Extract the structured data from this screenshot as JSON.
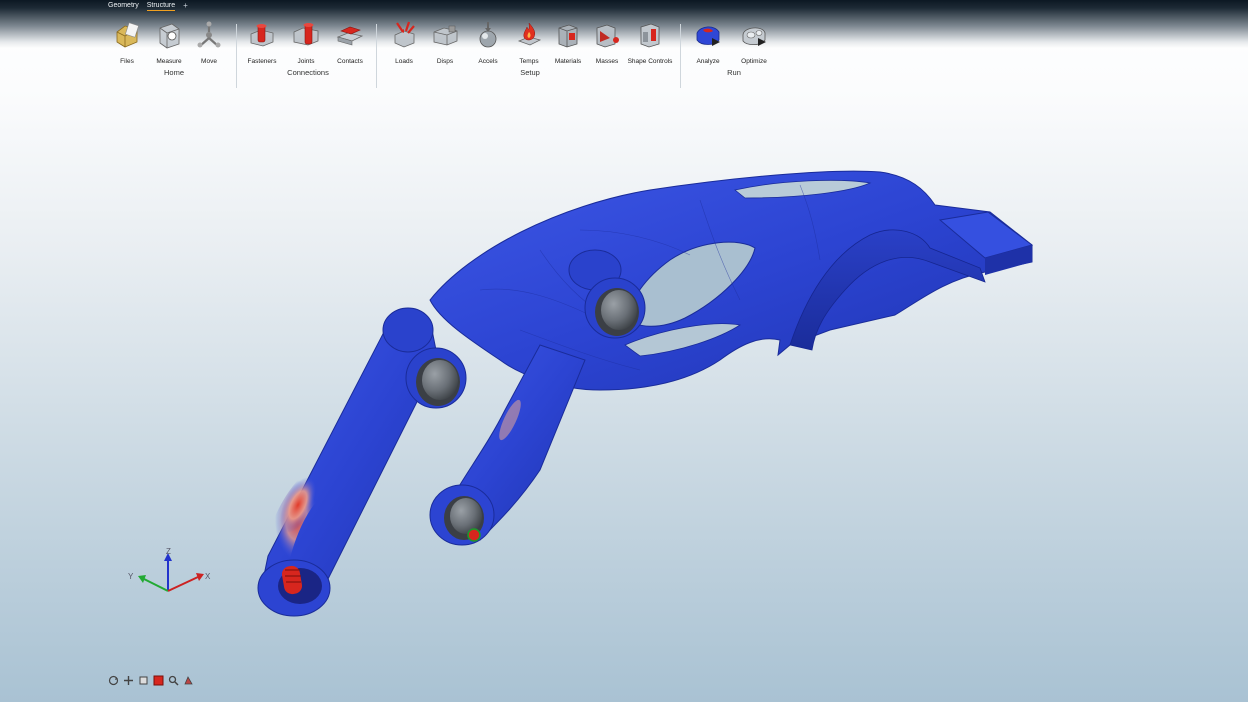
{
  "tabs": [
    {
      "label": "Geometry",
      "active": false
    },
    {
      "label": "Structure",
      "active": true
    }
  ],
  "tab_add": "+",
  "groups": {
    "home": {
      "label": "Home",
      "tools": [
        {
          "label": "Files",
          "icon": "files-icon"
        },
        {
          "label": "Measure",
          "icon": "measure-icon"
        },
        {
          "label": "Move",
          "icon": "move-icon"
        }
      ]
    },
    "connections": {
      "label": "Connections",
      "tools": [
        {
          "label": "Fasteners",
          "icon": "fasteners-icon"
        },
        {
          "label": "Joints",
          "icon": "joints-icon"
        },
        {
          "label": "Contacts",
          "icon": "contacts-icon"
        }
      ]
    },
    "setup": {
      "label": "Setup",
      "tools": [
        {
          "label": "Loads",
          "icon": "loads-icon"
        },
        {
          "label": "Disps",
          "icon": "disps-icon"
        },
        {
          "label": "Accels",
          "icon": "accels-icon"
        },
        {
          "label": "Temps",
          "icon": "temps-icon"
        },
        {
          "label": "Materials",
          "icon": "materials-icon"
        },
        {
          "label": "Masses",
          "icon": "masses-icon"
        },
        {
          "label": "Shape Controls",
          "icon": "shape-controls-icon"
        }
      ]
    },
    "run": {
      "label": "Run",
      "tools": [
        {
          "label": "Analyze",
          "icon": "analyze-icon"
        },
        {
          "label": "Optimize",
          "icon": "optimize-icon"
        }
      ]
    }
  },
  "triad": {
    "x": "X",
    "y": "Y",
    "z": "Z"
  },
  "colors": {
    "model_blue": "#2f47d6",
    "stress_red": "#d8221a",
    "accent_tab": "#f0a020"
  },
  "view_tools": [
    "rotate-view-icon",
    "pan-view-icon",
    "fit-view-icon",
    "section-view-icon",
    "zoom-view-icon",
    "render-mode-icon"
  ]
}
